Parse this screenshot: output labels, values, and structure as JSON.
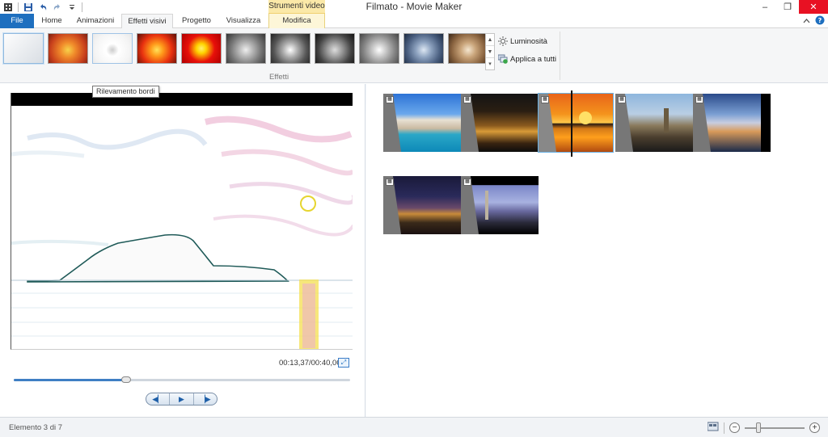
{
  "window": {
    "title": "Filmato - Movie Maker",
    "context_group": "Strumenti video",
    "minimize": "–",
    "restore": "❐",
    "close": "✕"
  },
  "tabs": [
    {
      "label": "File"
    },
    {
      "label": "Home"
    },
    {
      "label": "Animazioni"
    },
    {
      "label": "Effetti visivi"
    },
    {
      "label": "Progetto"
    },
    {
      "label": "Visualizza"
    },
    {
      "label": "Modifica"
    }
  ],
  "ribbon": {
    "group_label": "Effetti",
    "brightness_label": "Luminosità",
    "apply_all_label": "Applica a tutti",
    "effects": [
      {
        "name": "none"
      },
      {
        "name": "effect-2"
      },
      {
        "name": "Rilevamento bordi"
      },
      {
        "name": "effect-4"
      },
      {
        "name": "effect-5"
      },
      {
        "name": "effect-6"
      },
      {
        "name": "effect-7"
      },
      {
        "name": "effect-8"
      },
      {
        "name": "effect-9"
      },
      {
        "name": "effect-10"
      },
      {
        "name": "effect-11"
      }
    ],
    "tooltip": "Rilevamento bordi"
  },
  "preview": {
    "timecode": "00:13,37/00:40,00",
    "progress": 0.334
  },
  "storyboard": {
    "selected_index": 2
  },
  "status": {
    "text": "Elemento 3 di 7",
    "zoom_out": "−",
    "zoom_in": "+"
  },
  "colors": {
    "accent": "#1e6fbf",
    "context_tab": "#fbe9a8",
    "selection": "#6cb3e6"
  }
}
